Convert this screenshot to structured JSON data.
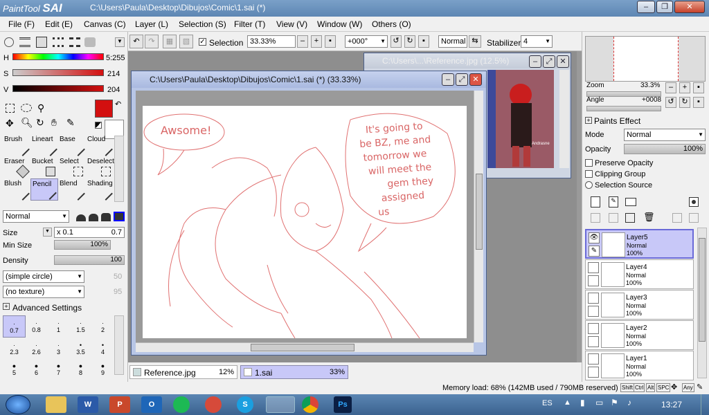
{
  "app": {
    "logo": "PaintTool",
    "logo_b": "SAI",
    "title": "C:\\Users\\Paula\\Desktop\\Dibujos\\Comic\\1.sai (*)"
  },
  "menus": [
    "File (F)",
    "Edit (E)",
    "Canvas (C)",
    "Layer (L)",
    "Selection (S)",
    "Filter (T)",
    "View (V)",
    "Window (W)",
    "Others (O)"
  ],
  "color": {
    "h_label": "H",
    "h_val": "5:255",
    "s_label": "S",
    "s_val": "214",
    "v_label": "V",
    "v_val": "204",
    "primary": "#d30f0f"
  },
  "toolbar": {
    "selection_label": "Selection",
    "zoom": "33.33%",
    "rotation": "+000°",
    "blend": "Normal",
    "stabilizer_label": "Stabilizer",
    "stabilizer_val": "4"
  },
  "tools": [
    {
      "label": "Brush"
    },
    {
      "label": "Lineart"
    },
    {
      "label": "Base"
    },
    {
      "label": "Cloud"
    },
    {
      "label": "Eraser"
    },
    {
      "label": "Bucket"
    },
    {
      "label": "Select"
    },
    {
      "label": "Deselect"
    },
    {
      "label": "Blush"
    },
    {
      "label": "Pencil"
    },
    {
      "label": "Blend"
    },
    {
      "label": "Shading"
    }
  ],
  "brush": {
    "mode": "Normal",
    "size_label": "Size",
    "size_mult": "x 0.1",
    "size_val": "0.7",
    "minsize_label": "Min Size",
    "minsize_val": "100%",
    "density_label": "Density",
    "density_val": "100",
    "shape": "(simple circle)",
    "shape_val": "50",
    "texture": "(no texture)",
    "texture_val": "95",
    "advanced": "Advanced Settings"
  },
  "brushsizes": [
    "0.7",
    "0.8",
    "1",
    "1.5",
    "2",
    "2.3",
    "2.6",
    "3",
    "3.5",
    "4",
    "5",
    "6",
    "7",
    "8",
    "9"
  ],
  "docs": {
    "ref_title": "C:\\Users\\...\\Reference.jpg (12.5%)",
    "main_title": "C:\\Users\\Paula\\Desktop\\Dibujos\\Comic\\1.sai (*) (33.33%)",
    "ref_caption": "Andrasne"
  },
  "canvas_text": {
    "bubble1": "Awsome!",
    "bubble2_1": "It's going to",
    "bubble2_2": "be BZ, me and",
    "bubble2_3": "tomorrow we",
    "bubble2_4": "will meet the",
    "bubble2_5": "gem they",
    "bubble2_6": "assigned",
    "bubble2_7": "us"
  },
  "tabs": [
    {
      "label": "Reference.jpg",
      "pct": "12%"
    },
    {
      "label": "1.sai",
      "pct": "33%"
    }
  ],
  "navigator": {
    "zoom_label": "Zoom",
    "zoom_val": "33.3%",
    "angle_label": "Angle",
    "angle_val": "+0008"
  },
  "layerprops": {
    "paints_effect": "Paints Effect",
    "mode_label": "Mode",
    "mode_val": "Normal",
    "opacity_label": "Opacity",
    "opacity_val": "100%",
    "preserve": "Preserve Opacity",
    "clipping": "Clipping Group",
    "selsource": "Selection Source"
  },
  "layers": [
    {
      "name": "Layer5",
      "mode": "Normal",
      "opacity": "100%"
    },
    {
      "name": "Layer4",
      "mode": "Normal",
      "opacity": "100%"
    },
    {
      "name": "Layer3",
      "mode": "Normal",
      "opacity": "100%"
    },
    {
      "name": "Layer2",
      "mode": "Normal",
      "opacity": "100%"
    },
    {
      "name": "Layer1",
      "mode": "Normal",
      "opacity": "100%"
    }
  ],
  "status": {
    "memory": "Memory load: 68% (142MB used / 790MB reserved)",
    "keys": [
      "Shift",
      "Ctrl",
      "Alt",
      "SPC",
      "Any"
    ]
  },
  "taskbar": {
    "lang": "ES",
    "time": "13:27"
  }
}
